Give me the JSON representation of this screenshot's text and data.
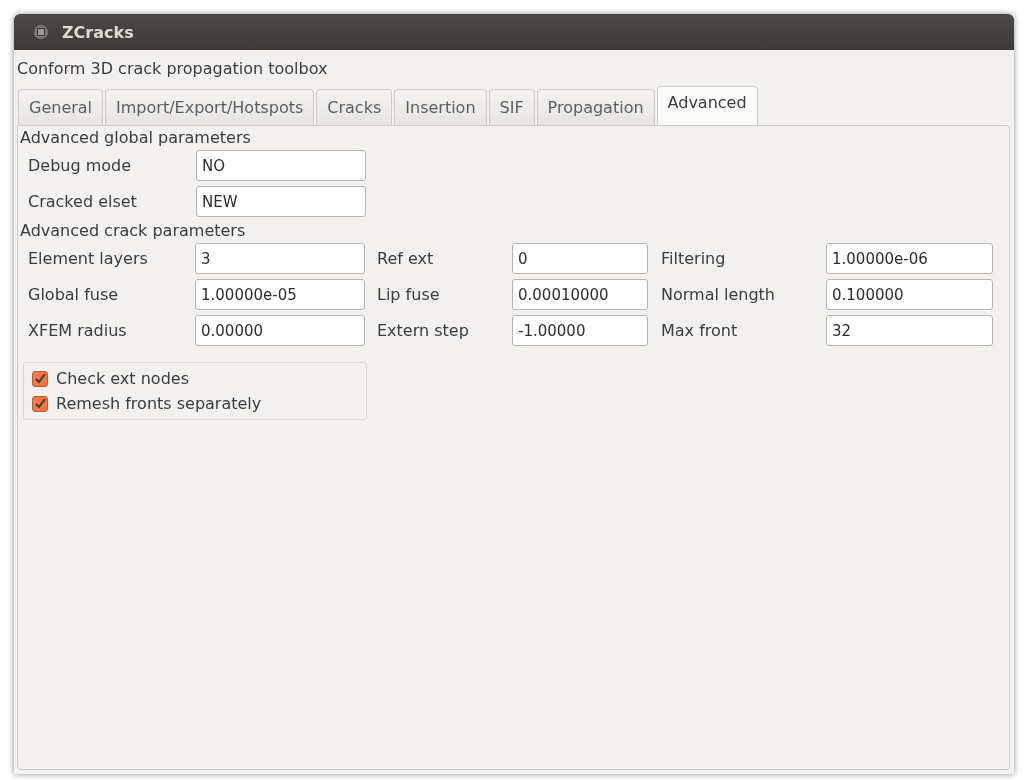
{
  "window": {
    "title": "ZCracks"
  },
  "subtitle": "Conform 3D crack propagation toolbox",
  "tabs": [
    {
      "label": "General",
      "selected": false
    },
    {
      "label": "Import/Export/Hotspots",
      "selected": false
    },
    {
      "label": "Cracks",
      "selected": false
    },
    {
      "label": "Insertion",
      "selected": false
    },
    {
      "label": "SIF",
      "selected": false
    },
    {
      "label": "Propagation",
      "selected": false
    },
    {
      "label": "Advanced",
      "selected": true
    }
  ],
  "global_section": {
    "heading": "Advanced global parameters",
    "fields": [
      {
        "label": "Debug mode",
        "value": "NO"
      },
      {
        "label": "Cracked elset",
        "value": "NEW"
      }
    ]
  },
  "crack_section": {
    "heading": "Advanced crack parameters",
    "fields": [
      {
        "label": "Element layers",
        "value": "3"
      },
      {
        "label": "Ref ext",
        "value": "0"
      },
      {
        "label": "Filtering",
        "value": "1.00000e-06"
      },
      {
        "label": "Global fuse",
        "value": "1.00000e-05"
      },
      {
        "label": "Lip fuse",
        "value": "0.00010000"
      },
      {
        "label": "Normal length",
        "value": "0.100000"
      },
      {
        "label": "XFEM radius",
        "value": "0.00000"
      },
      {
        "label": "Extern step",
        "value": "-1.00000"
      },
      {
        "label": "Max front",
        "value": "32"
      }
    ]
  },
  "options": [
    {
      "label": "Check ext nodes",
      "checked": true
    },
    {
      "label": "Remesh fronts separately",
      "checked": true
    }
  ]
}
